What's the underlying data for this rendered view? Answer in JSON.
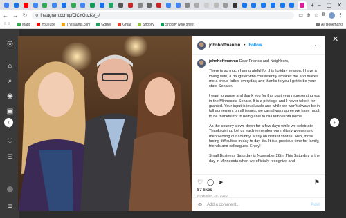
{
  "browser": {
    "url": "instagram.com/p/CICYGuzKe_-/",
    "bookmarks": [
      {
        "label": "Maps",
        "color": "#34a853"
      },
      {
        "label": "YouTube",
        "color": "#ff0000"
      },
      {
        "label": "Thesaurus.com",
        "color": "#f4a300"
      },
      {
        "label": "Gdrive",
        "color": "#1fa463"
      },
      {
        "label": "Gmail",
        "color": "#ea4335"
      },
      {
        "label": "Shopify",
        "color": "#95bf47"
      },
      {
        "label": "Shopify work sheet",
        "color": "#0f9d58"
      }
    ],
    "all_bookmarks": "All Bookmarks"
  },
  "post": {
    "username": "johnhoffmanmn",
    "follow": "Follow",
    "caption_intro": "Dear Friends and Neighbors,",
    "paragraphs": [
      "There is so much I am grateful for this holiday season. I have a loving wife, a daughter who consistently amazes me and makes me a proud father everyday, and thanks to you I get to be your state Senator.",
      "I want to pause and thank you for this past year representing you in the Minnesota Senate. It is a privilege and I never take it for granted. Your input is invaluable and while we won't always be in full agreement on all issues, we can always agree we have much to be thankful for in being able to call Minnesota home.",
      "As the country slows down for a few days while we celebrate Thanksgiving, Let us each remember our military women and men serving our country. Many on distant shores. Also, those facing difficulties in day to day life. It is a precious time for family, friends and colleagues. Enjoy!",
      "Small Business Saturday is November 28th. This Saturday is the day in Minnesota when we officially recognize and"
    ],
    "likes": "87 likes",
    "date": "November 26, 2020",
    "comment_placeholder": "Add a comment...",
    "post_button": "Post"
  }
}
